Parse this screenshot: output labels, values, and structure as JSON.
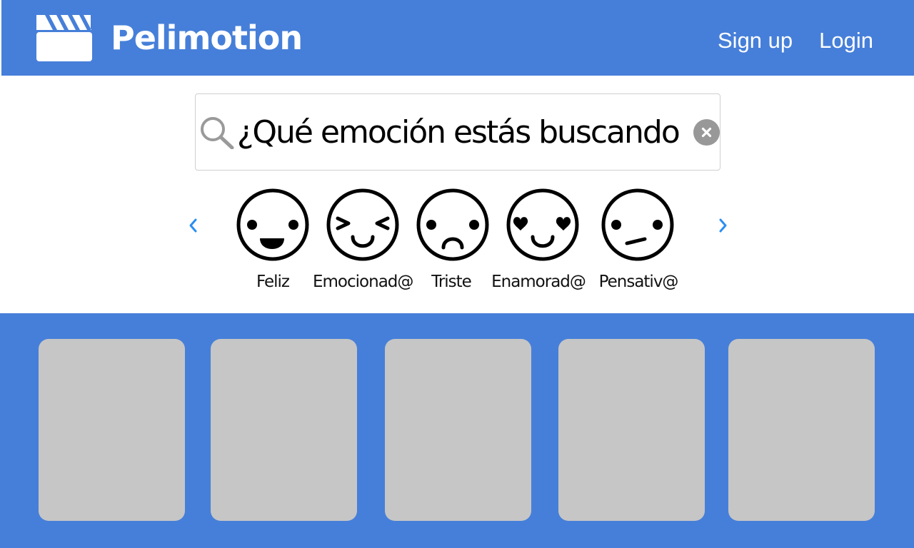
{
  "brand": {
    "name": "Pelimotion",
    "icon": "clapperboard-icon"
  },
  "nav": {
    "signup_label": "Sign up",
    "login_label": "Login"
  },
  "search": {
    "placeholder": "¿Qué emoción estás buscando?",
    "value": "",
    "icon": "search-icon",
    "clear_icon": "clear-icon"
  },
  "emotions": {
    "prev_icon": "chevron-left-icon",
    "next_icon": "chevron-right-icon",
    "items": [
      {
        "label": "Feliz",
        "icon": "happy-face-icon"
      },
      {
        "label": "Emocionad@",
        "icon": "excited-face-icon"
      },
      {
        "label": "Triste",
        "icon": "sad-face-icon"
      },
      {
        "label": "Enamorad@",
        "icon": "in-love-face-icon"
      },
      {
        "label": "Pensativ@",
        "icon": "thinking-face-icon"
      }
    ]
  },
  "movies": {
    "count": 5
  },
  "colors": {
    "primary": "#467fd9",
    "card_placeholder": "#c6c6c6",
    "arrow": "#2b8ef3",
    "clear_button": "#989898",
    "search_icon": "#9a9a9a"
  }
}
